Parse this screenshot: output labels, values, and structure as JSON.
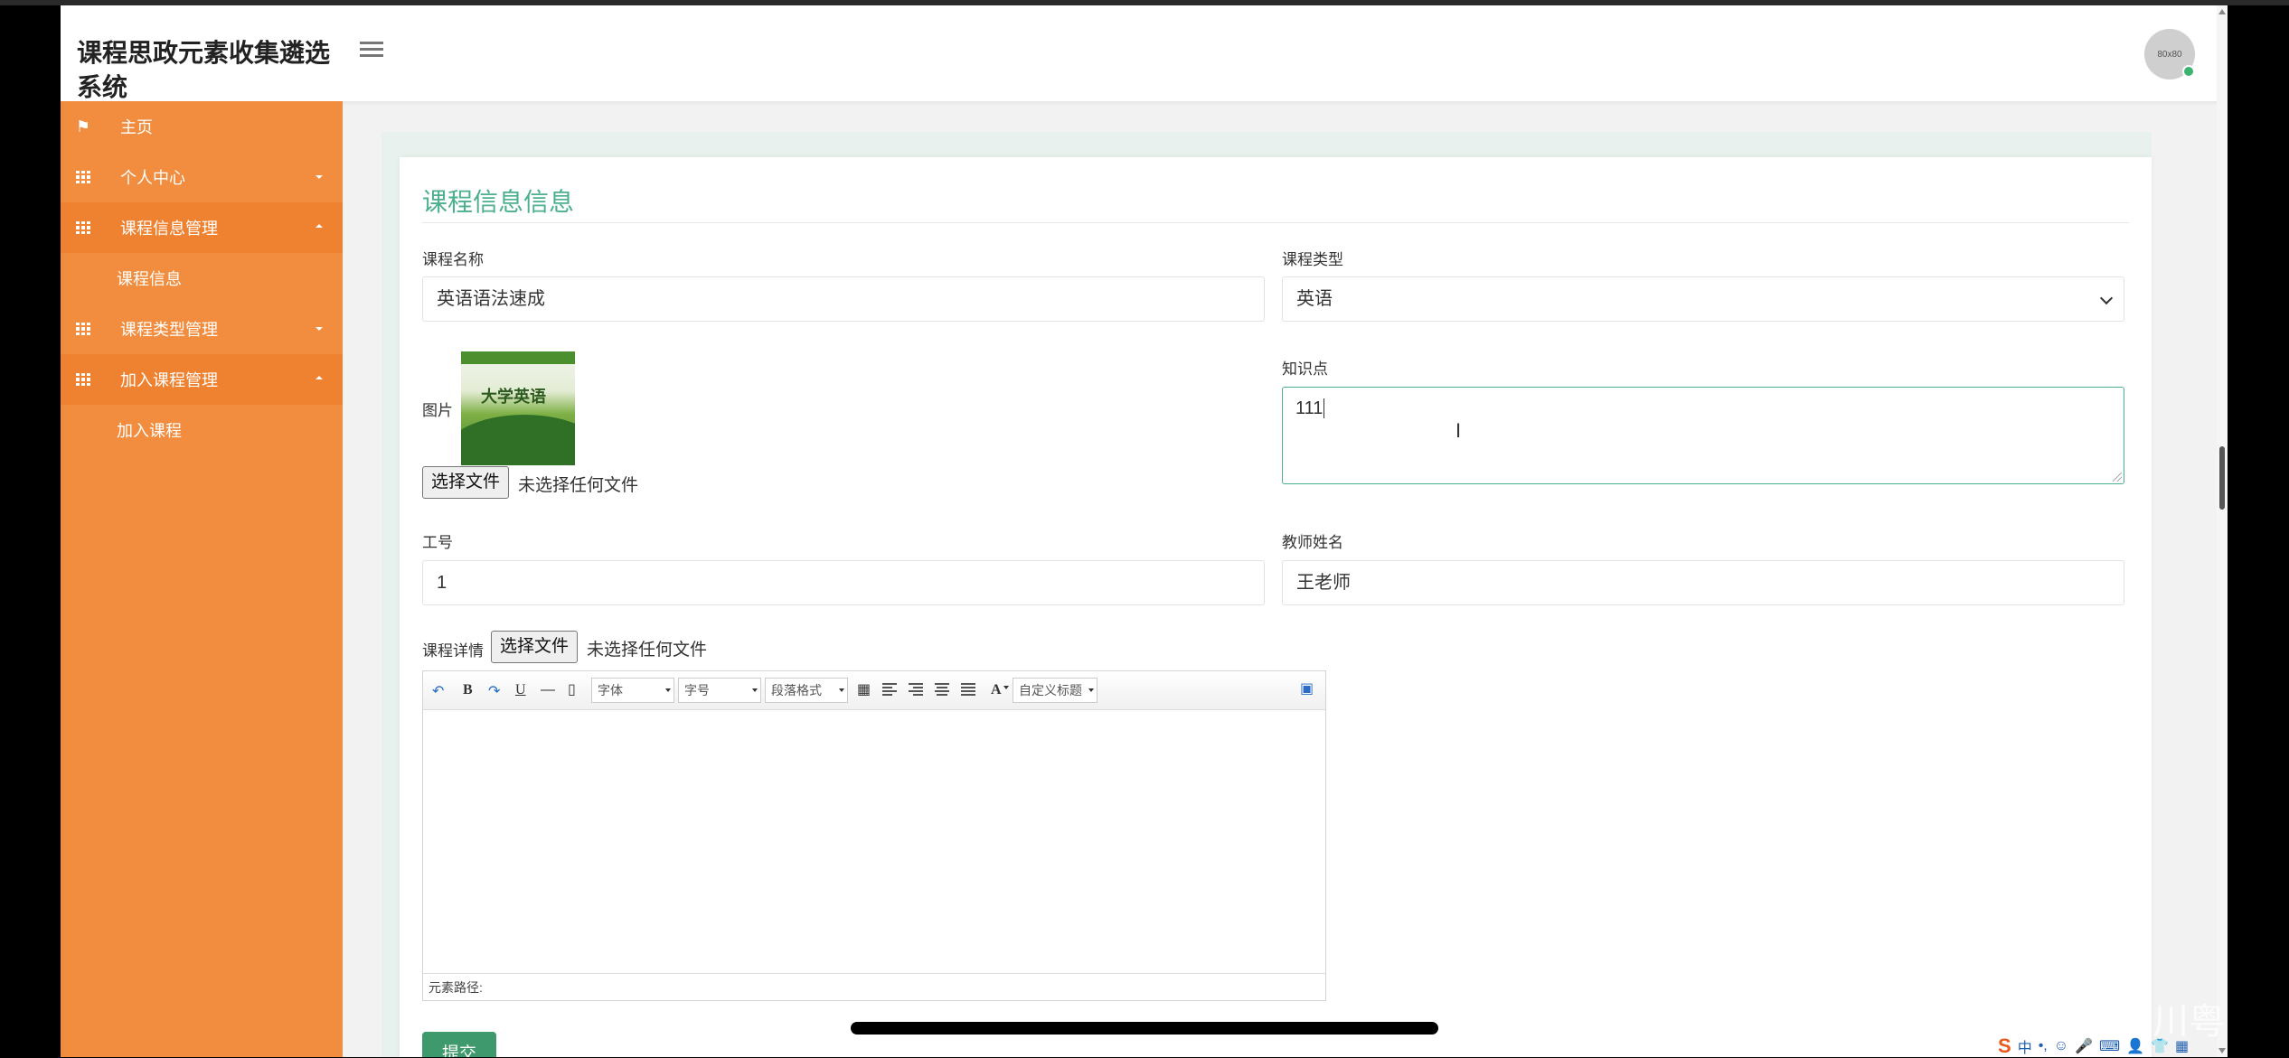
{
  "app": {
    "title": "课程思政元素收集遴选系统"
  },
  "header": {
    "avatar_text": "80x80"
  },
  "sidebar": {
    "items": [
      {
        "label": "主页"
      },
      {
        "label": "个人中心"
      },
      {
        "label": "课程信息管理"
      },
      {
        "label": "课程信息"
      },
      {
        "label": "课程类型管理"
      },
      {
        "label": "加入课程管理"
      },
      {
        "label": "加入课程"
      }
    ]
  },
  "form": {
    "title": "课程信息信息",
    "course_name": {
      "label": "课程名称",
      "value": "英语语法速成"
    },
    "course_type": {
      "label": "课程类型",
      "value": "英语"
    },
    "image": {
      "label": "图片",
      "thumb_text": "大学英语",
      "file_button": "选择文件",
      "file_status": "未选择任何文件"
    },
    "knowledge": {
      "label": "知识点",
      "value": "111"
    },
    "staff_id": {
      "label": "工号",
      "value": "1"
    },
    "teacher_name": {
      "label": "教师姓名",
      "value": "王老师"
    },
    "detail": {
      "label": "课程详情",
      "file_button": "选择文件",
      "file_status": "未选择任何文件"
    },
    "submit_label": "提交"
  },
  "editor": {
    "toolbar": {
      "bold": "B",
      "underline": "U",
      "hr": "—",
      "font_family": "字体",
      "font_size": "字号",
      "paragraph": "段落格式",
      "font_color": "A",
      "custom_title": "自定义标题"
    },
    "status": "元素路径:"
  },
  "overlay": {
    "watermark": "CSDN @山山而川粤",
    "tray_items": [
      "S",
      "中",
      "•,",
      "☺",
      "🎤",
      "⌨",
      "👤",
      "👕",
      "▦"
    ]
  }
}
